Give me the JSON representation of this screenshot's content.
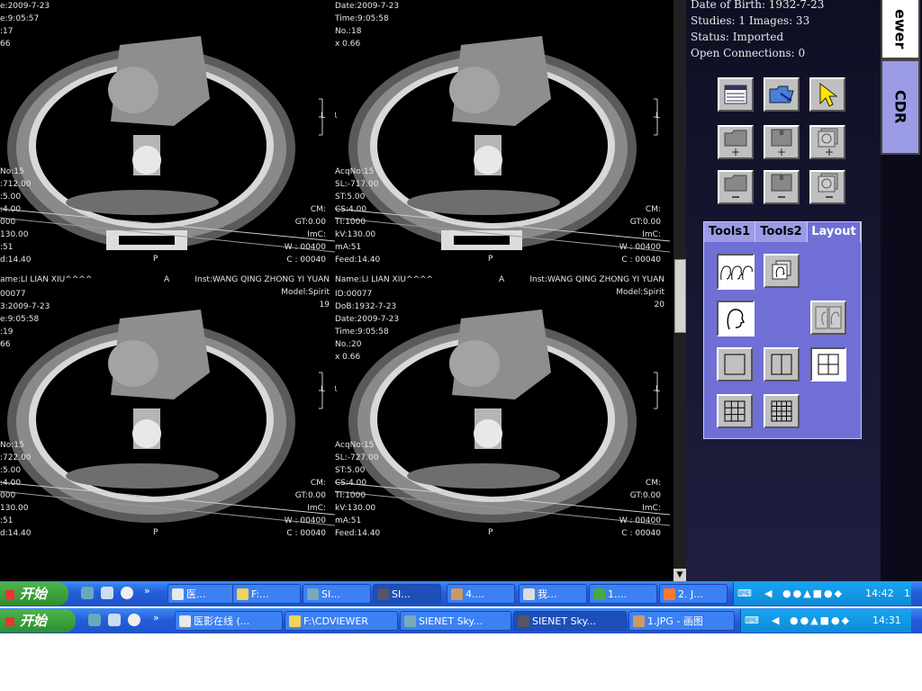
{
  "viewer": {
    "cells": [
      {
        "tl": [
          "e:2009-7-23",
          "e:9:05:57",
          ":17",
          "66"
        ],
        "bl": [
          "No:15",
          ":712.00",
          ":5.00",
          ":4.00",
          "000",
          "130.00",
          ":51",
          "d:14.40"
        ],
        "br": [
          "CM:",
          "GT:0.00",
          "ImC:",
          "W : 00400",
          "C : 00040"
        ],
        "orient_l": "",
        "orient_r": "L",
        "orient_b": "P"
      },
      {
        "tl": [
          "Date:2009-7-23",
          "Time:9:05:58",
          "No.:18",
          "x 0.66"
        ],
        "bl": [
          "AcqNo:15",
          "SL:-717.00",
          "ST:5.00",
          "CS:4.00",
          "TI:1000",
          "kV:130.00",
          "mA:51",
          "Feed:14.40"
        ],
        "br": [
          "CM:",
          "GT:0.00",
          "ImC:",
          "W : 00400",
          "C : 00040"
        ],
        "orient_l": "R",
        "orient_r": "L",
        "orient_b": "P"
      },
      {
        "top_left": "ame:LI LIAN XIU^^^^",
        "top_center": "A",
        "inst": "Inst:WANG QING ZHONG YI YUAN",
        "model": "Model:Spirit",
        "num": "19",
        "tl": [
          "00077",
          "3:2009-7-23",
          "e:9:05:58",
          ":19",
          "66"
        ],
        "bl": [
          "No:15",
          ":722.00",
          ":5.00",
          ":4.00",
          "000",
          "130.00",
          ":51",
          "d:14.40"
        ],
        "br": [
          "CM:",
          "GT:0.00",
          "ImC:",
          "W : 00400",
          "C : 00040"
        ],
        "orient_l": "",
        "orient_r": "L",
        "orient_b": "P"
      },
      {
        "top_left": "Name:LI LIAN XIU^^^^",
        "top_center": "A",
        "inst": "Inst:WANG QING ZHONG YI YUAN",
        "model": "Model:Spirit",
        "num": "20",
        "tl": [
          "ID:00077",
          "DoB:1932-7-23",
          "Date:2009-7-23",
          "Time:9:05:58",
          "No.:20",
          "x 0.66"
        ],
        "bl": [
          "AcqNo:15",
          "SL:-727.00",
          "ST:5.00",
          "CS:4.00",
          "TI:1000",
          "kV:130.00",
          "mA:51",
          "Feed:14.40"
        ],
        "br": [
          "CM:",
          "GT:0.00",
          "ImC:",
          "W : 00400",
          "C : 00040"
        ],
        "orient_l": "R",
        "orient_r": "L",
        "orient_b": "P"
      }
    ]
  },
  "panel": {
    "date_of_birth": "Date of Birth: 1932-7-23",
    "studies": "Studies: 1 Images: 33",
    "status": "Status: Imported",
    "open_connections": "Open Connections: 0",
    "tabs": [
      "Tools1",
      "Tools2",
      "Layout"
    ],
    "active_tab": "Layout"
  },
  "side_tabs": [
    "ewer",
    "CDR"
  ],
  "taskbar_top": {
    "start": "开始",
    "items": [
      "医...",
      "F:...",
      "SI...",
      "SI...",
      "4....",
      "我...",
      "1....",
      "2. J..."
    ],
    "clock": "14:42",
    "extra": "1"
  },
  "taskbar_bottom": {
    "start": "开始",
    "items": [
      "医影在线 (...",
      "F:\\CDVIEWER",
      "SIENET Sky...",
      "SIENET Sky...",
      "1.JPG - 画图"
    ],
    "clock": "14:31"
  },
  "colors": {
    "panel_bg": "#1a1a38",
    "tools_bg": "#6f6fd6",
    "taskbar": "#245edb",
    "start": "#3a9d3a"
  }
}
